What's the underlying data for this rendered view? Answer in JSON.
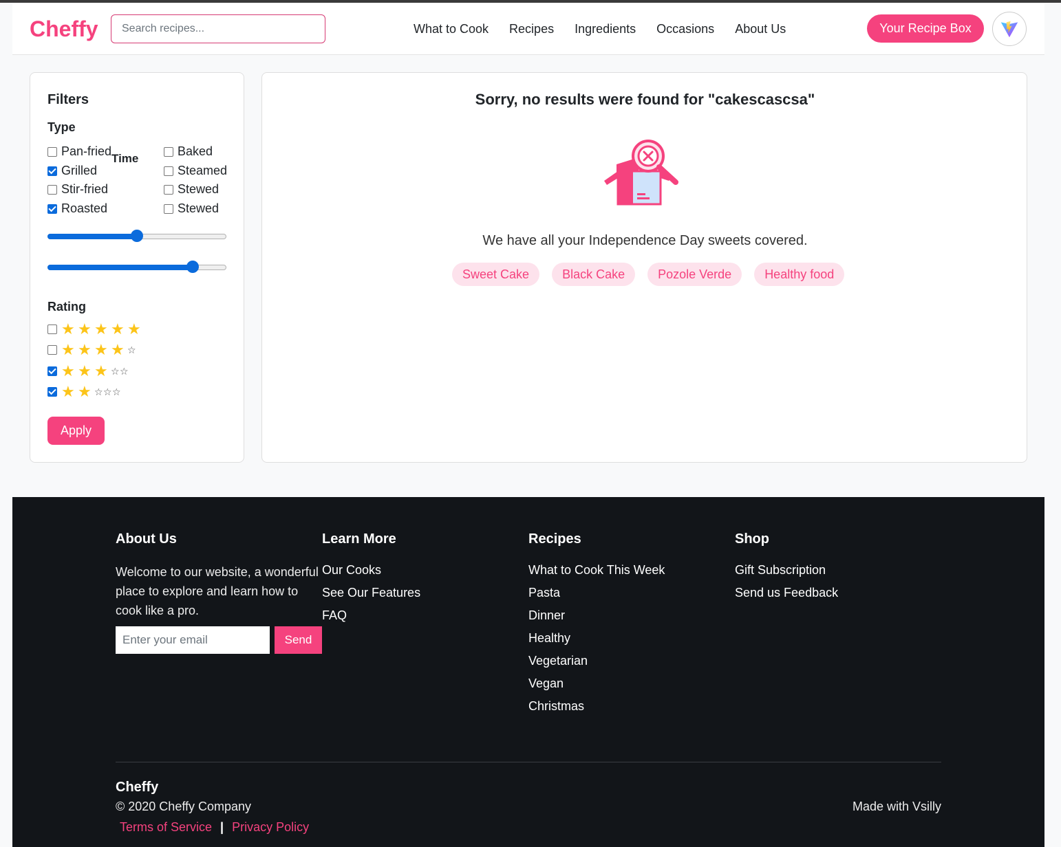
{
  "header": {
    "logo": "Cheffy",
    "search_placeholder": "Search recipes...",
    "nav": [
      "What to Cook",
      "Recipes",
      "Ingredients",
      "Occasions",
      "About Us"
    ],
    "recipe_box_label": "Your Recipe Box"
  },
  "filters": {
    "title": "Filters",
    "type_label": "Type",
    "time_label": "Time",
    "type_options": [
      {
        "label": "Pan-fried",
        "checked": false
      },
      {
        "label": "Grilled",
        "checked": true
      },
      {
        "label": "Stir-fried",
        "checked": false
      },
      {
        "label": "Roasted",
        "checked": true
      }
    ],
    "time_options": [
      {
        "label": "Baked",
        "checked": false
      },
      {
        "label": "Steamed",
        "checked": false
      },
      {
        "label": "Stewed",
        "checked": false
      },
      {
        "label": "Stewed",
        "checked": false
      }
    ],
    "slider1_level": 0.5,
    "slider2_level": 0.81,
    "rating_label": "Rating",
    "ratings": [
      {
        "stars": 5,
        "checked": false
      },
      {
        "stars": 4,
        "checked": false
      },
      {
        "stars": 3,
        "checked": true
      },
      {
        "stars": 2,
        "checked": true
      }
    ],
    "apply_label": "Apply"
  },
  "results": {
    "title": "Sorry, no results were found for \"cakescascsa\"",
    "message": "We have all your Independence Day sweets covered.",
    "suggestions": [
      "Sweet Cake",
      "Black Cake",
      "Pozole Verde",
      "Healthy food"
    ]
  },
  "footer": {
    "about": {
      "title": "About Us",
      "text": "Welcome to our website, a wonderful place to explore and learn how to cook like a pro.",
      "email_placeholder": "Enter your email",
      "send_label": "Send"
    },
    "learn_more": {
      "title": "Learn More",
      "links": [
        "Our Cooks",
        "See Our Features",
        "FAQ"
      ]
    },
    "recipes": {
      "title": "Recipes",
      "links": [
        "What to Cook This Week",
        "Pasta",
        "Dinner",
        "Healthy",
        "Vegetarian",
        "Vegan",
        "Christmas"
      ]
    },
    "shop": {
      "title": "Shop",
      "links": [
        "Gift Subscription",
        "Send us Feedback"
      ]
    },
    "brand": "Cheffy",
    "copyright": "© 2020 Cheffy Company",
    "terms_label": "Terms of Service",
    "separator": "|",
    "privacy_label": "Privacy Policy",
    "made_with": "Made with Vsilly"
  },
  "colors": {
    "brand": "#f5427e",
    "chip_bg": "#fde2ec",
    "footer_bg": "#121519",
    "checkbox": "#0b6bdc",
    "star": "#fcc419"
  }
}
